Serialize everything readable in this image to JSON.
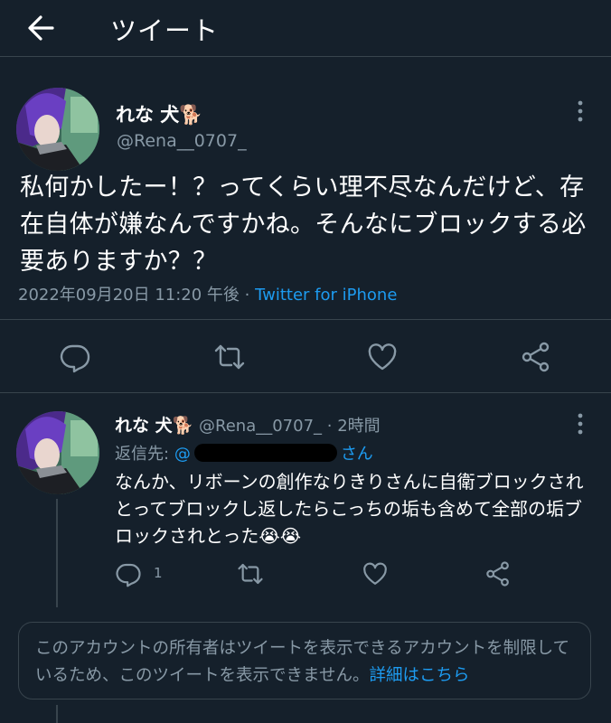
{
  "header": {
    "title": "ツイート"
  },
  "main_tweet": {
    "name": "れな 犬🐕",
    "handle": "@Rena__0707_",
    "text": "私何かしたー！？ってくらい理不尽なんだけど、存在自体が嫌なんですかね。そんなにブロックする必要ありますか？？",
    "timestamp": "2022年09月20日 11:20 午後",
    "meta_sep": " · ",
    "source": "Twitter for iPhone"
  },
  "reply_tweet": {
    "name": "れな 犬🐕",
    "handle": "@Rena__0707_",
    "dot": " · ",
    "time": "2時間",
    "reply_to_label": "返信先:",
    "reply_to_prefix": "@",
    "reply_to_suffix": "さん",
    "text": "なんか、リボーンの創作なりきりさんに自衛ブロックされとってブロックし返したらこっちの垢も含めて全部の垢ブロックされとった😭😭",
    "reply_count": "1"
  },
  "notice": {
    "text": "このアカウントの所有者はツイートを表示できるアカウントを制限しているため、このツイートを表示できません。",
    "link": "詳細はこちら"
  },
  "colors": {
    "background": "#15202b",
    "border": "#38444d",
    "secondary_text": "#8899a6",
    "accent": "#1d9bf0"
  },
  "icons": [
    "back-arrow-icon",
    "more-vertical-icon",
    "reply-icon",
    "retweet-icon",
    "like-icon",
    "share-icon"
  ]
}
